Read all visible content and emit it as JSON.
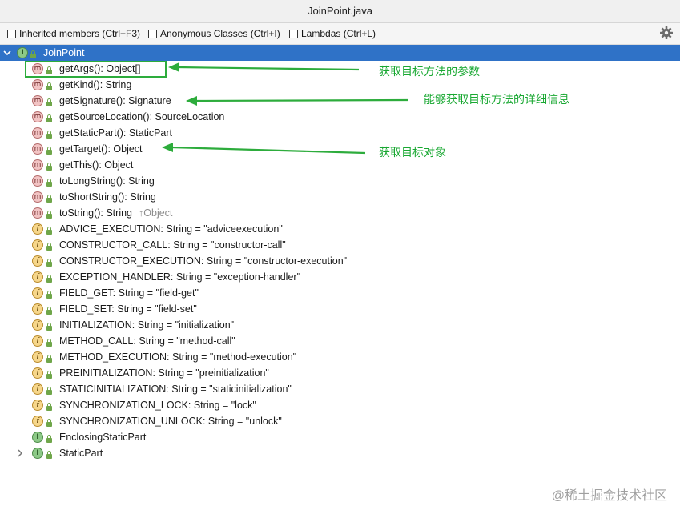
{
  "window": {
    "title": "JoinPoint.java"
  },
  "toolbar": {
    "checkboxes": [
      {
        "label": "Inherited members (Ctrl+F3)",
        "checked": false
      },
      {
        "label": "Anonymous Classes (Ctrl+I)",
        "checked": false
      },
      {
        "label": "Lambdas (Ctrl+L)",
        "checked": false
      }
    ],
    "settings_icon": "gear-icon"
  },
  "tree": {
    "root": {
      "label": "JoinPoint",
      "icon": "interface-icon",
      "expanded": true
    },
    "items": [
      {
        "kind": "m",
        "label": "getArgs(): Object[]"
      },
      {
        "kind": "m",
        "label": "getKind(): String"
      },
      {
        "kind": "m",
        "label": "getSignature(): Signature"
      },
      {
        "kind": "m",
        "label": "getSourceLocation(): SourceLocation"
      },
      {
        "kind": "m",
        "label": "getStaticPart(): StaticPart"
      },
      {
        "kind": "m",
        "label": "getTarget(): Object"
      },
      {
        "kind": "m",
        "label": "getThis(): Object"
      },
      {
        "kind": "m",
        "label": "toLongString(): String"
      },
      {
        "kind": "m",
        "label": "toShortString(): String"
      },
      {
        "kind": "m",
        "label": "toString(): String",
        "inherited": "↑Object"
      },
      {
        "kind": "f",
        "label": "ADVICE_EXECUTION: String = \"adviceexecution\""
      },
      {
        "kind": "f",
        "label": "CONSTRUCTOR_CALL: String = \"constructor-call\""
      },
      {
        "kind": "f",
        "label": "CONSTRUCTOR_EXECUTION: String = \"constructor-execution\""
      },
      {
        "kind": "f",
        "label": "EXCEPTION_HANDLER: String = \"exception-handler\""
      },
      {
        "kind": "f",
        "label": "FIELD_GET: String = \"field-get\""
      },
      {
        "kind": "f",
        "label": "FIELD_SET: String = \"field-set\""
      },
      {
        "kind": "f",
        "label": "INITIALIZATION: String = \"initialization\""
      },
      {
        "kind": "f",
        "label": "METHOD_CALL: String = \"method-call\""
      },
      {
        "kind": "f",
        "label": "METHOD_EXECUTION: String = \"method-execution\""
      },
      {
        "kind": "f",
        "label": "PREINITIALIZATION: String = \"preinitialization\""
      },
      {
        "kind": "f",
        "label": "STATICINITIALIZATION: String = \"staticinitialization\""
      },
      {
        "kind": "f",
        "label": "SYNCHRONIZATION_LOCK: String = \"lock\""
      },
      {
        "kind": "f",
        "label": "SYNCHRONIZATION_UNLOCK: String = \"unlock\""
      },
      {
        "kind": "i",
        "label": "EnclosingStaticPart",
        "expandable": false
      },
      {
        "kind": "i",
        "label": "StaticPart",
        "expandable": true
      }
    ]
  },
  "annotations": {
    "args_note": "获取目标方法的参数",
    "signature_note": "能够获取目标方法的详细信息",
    "target_note": "获取目标对象",
    "color": "#19a832"
  },
  "watermark": "@稀土掘金技术社区",
  "colors": {
    "selection": "#2f72c7",
    "accent_green": "#2dac3c"
  }
}
